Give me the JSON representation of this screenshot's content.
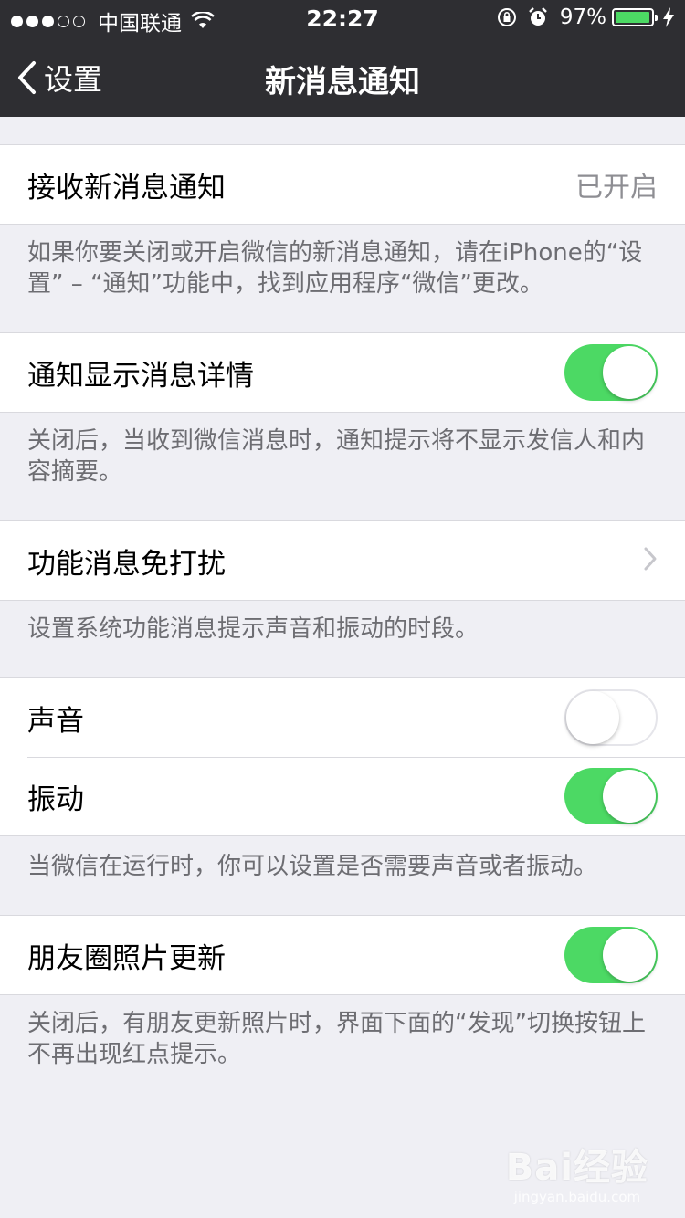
{
  "status_bar": {
    "carrier": "中国联通",
    "time": "22:27",
    "battery": "97%",
    "signal_level": 3,
    "signal_max": 5
  },
  "nav": {
    "back_label": "设置",
    "title": "新消息通知"
  },
  "sections": {
    "receive": {
      "label": "接收新消息通知",
      "value": "已开启",
      "footer": "如果你要关闭或开启微信的新消息通知，请在iPhone的“设置” – “通知”功能中，找到应用程序“微信”更改。"
    },
    "details": {
      "label": "通知显示消息详情",
      "toggle_on": true,
      "footer": "关闭后，当收到微信消息时，通知提示将不显示发信人和内容摘要。"
    },
    "dnd": {
      "label": "功能消息免打扰",
      "footer": "设置系统功能消息提示声音和振动的时段。"
    },
    "sound": {
      "label": "声音",
      "toggle_on": false
    },
    "vibrate": {
      "label": "振动",
      "toggle_on": true,
      "footer": "当微信在运行时，你可以设置是否需要声音或者振动。"
    },
    "moments": {
      "label": "朋友圈照片更新",
      "toggle_on": true,
      "footer": "关闭后，有朋友更新照片时，界面下面的“发现”切换按钮上不再出现红点提示。"
    }
  },
  "watermark": {
    "logo": "Bai经验",
    "url": "jingyan.baidu.com"
  },
  "colors": {
    "nav_bg": "#2e2e32",
    "toggle_on": "#4cd964",
    "page_bg": "#efeff4"
  }
}
